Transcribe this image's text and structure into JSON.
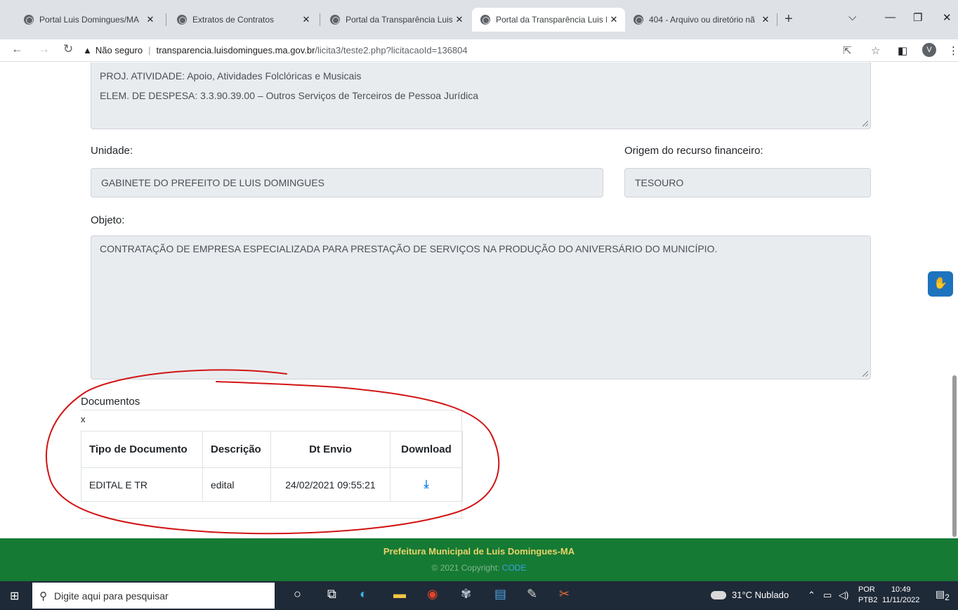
{
  "browser": {
    "tabs": [
      {
        "title": "Portal Luis Domingues/MA",
        "active": false
      },
      {
        "title": "Extratos de Contratos",
        "active": false
      },
      {
        "title": "Portal da Transparência Luis D",
        "active": false
      },
      {
        "title": "Portal da Transparência Luis D",
        "active": true
      },
      {
        "title": "404 - Arquivo ou diretório nã",
        "active": false
      }
    ],
    "new_tab": "+",
    "address": {
      "security_label": "Não seguro",
      "host": "transparencia.luisdomingues.ma.gov.br",
      "path": "/licita3/teste2.php?licitacaoId=136804"
    },
    "profile_initial": "V"
  },
  "form": {
    "dotacao_lines": [
      "PROJ. ATIVIDADE: Apoio, Atividades Folclóricas e Musicais",
      "ELEM. DE DESPESA: 3.3.90.39.00 – Outros Serviços de Terceiros de Pessoa Jurídica"
    ],
    "unidade_label": "Unidade:",
    "unidade_value": "GABINETE DO PREFEITO DE LUIS DOMINGUES",
    "origem_label": "Origem do recurso financeiro:",
    "origem_value": "TESOURO",
    "objeto_label": "Objeto:",
    "objeto_value": "CONTRATAÇÃO DE EMPRESA ESPECIALIZADA PARA PRESTAÇÃO DE SERVIÇOS NA PRODUÇÃO DO ANIVERSÁRIO DO MUNICÍPIO."
  },
  "documents": {
    "title": "Documentos",
    "close_mark": "x",
    "columns": [
      "Tipo de Documento",
      "Descrição",
      "Dt Envio",
      "Download"
    ],
    "rows": [
      {
        "tipo": "EDITAL E TR",
        "descricao": "edital",
        "dt_envio": "24/02/2021 09:55:21",
        "download_icon": "download-icon"
      }
    ]
  },
  "footer": {
    "title": "Prefeitura Municipal de Luis Domingues-MA",
    "copyright": "© 2021 Copyright:",
    "link": "CODE"
  },
  "taskbar": {
    "search_placeholder": "Digite aqui para pesquisar",
    "weather": "31°C  Nublado",
    "lang_top": "POR",
    "lang_bottom": "PTB2",
    "time": "10:49",
    "date": "11/11/2022",
    "notifications": "2"
  },
  "colors": {
    "footer_bg": "#157a34",
    "footer_title": "#e8d36a",
    "annotation_red": "#d21414",
    "readonly_field": "#e9ecef",
    "accent_blue": "#1e73be"
  }
}
